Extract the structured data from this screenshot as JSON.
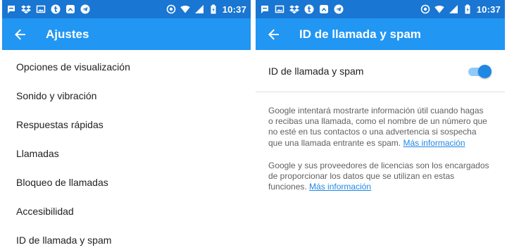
{
  "status_bar": {
    "time": "10:37",
    "notification_icons": [
      "sms-icon",
      "dropbox-icon",
      "image-icon",
      "tumblr-icon",
      "feedly-icon",
      "telegram-icon"
    ],
    "system_icons": [
      "nfc-icon",
      "wifi-icon",
      "cellular-signal-icon",
      "battery-icon"
    ],
    "color": "#1976d2"
  },
  "left": {
    "app_bar": {
      "title": "Ajustes",
      "color": "#2196f3"
    },
    "items": [
      {
        "label": "Opciones de visualización"
      },
      {
        "label": "Sonido y vibración"
      },
      {
        "label": "Respuestas rápidas"
      },
      {
        "label": "Llamadas"
      },
      {
        "label": "Bloqueo de llamadas"
      },
      {
        "label": "Accesibilidad"
      },
      {
        "label": "ID de llamada y spam"
      }
    ]
  },
  "right": {
    "app_bar": {
      "title": "ID de llamada y spam",
      "color": "#2196f3"
    },
    "toggle": {
      "label": "ID de llamada y spam",
      "checked": true,
      "accent": "#1e88e5"
    },
    "description_1": {
      "text": "Google intentará mostrarte información útil cuando hagas o recibas una llamada, como el nombre de un número que no esté en tus contactos o una advertencia si sospecha que una llamada entrante es spam. ",
      "link": "Más información"
    },
    "description_2": {
      "text": "Google y sus proveedores de licencias son los encargados de proporcionar los datos que se utilizan en estas funciones. ",
      "link": "Más información"
    }
  }
}
